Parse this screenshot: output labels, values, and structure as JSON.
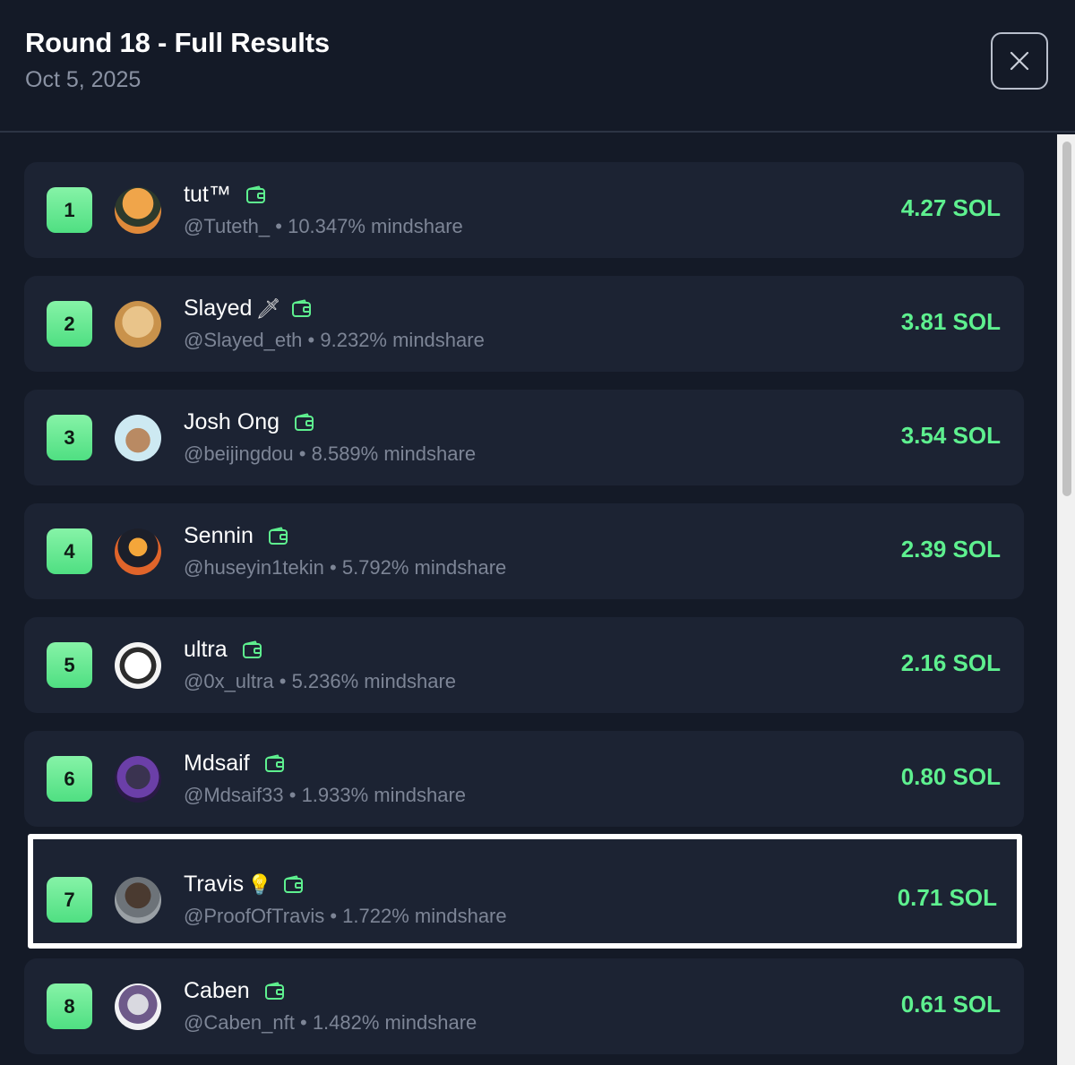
{
  "header": {
    "title": "Round 18 - Full Results",
    "date": "Oct 5, 2025"
  },
  "icons": {
    "close": "close-icon",
    "wallet": "wallet-icon"
  },
  "colors": {
    "accent": "#5ef08f",
    "rank_badge": "#5ee38c",
    "background": "#141a27",
    "card": "#1c2333",
    "muted_text": "#7d8596"
  },
  "results": [
    {
      "rank": "1",
      "name": "tut™",
      "emoji": "",
      "handle": "@Tuteth_",
      "mindshare": "10.347% mindshare",
      "reward": "4.27 SOL",
      "highlighted": false
    },
    {
      "rank": "2",
      "name": "Slayed",
      "emoji": "🗡",
      "handle": "@Slayed_eth",
      "mindshare": "9.232% mindshare",
      "reward": "3.81 SOL",
      "highlighted": false
    },
    {
      "rank": "3",
      "name": "Josh Ong",
      "emoji": "",
      "handle": "@beijingdou",
      "mindshare": "8.589% mindshare",
      "reward": "3.54 SOL",
      "highlighted": false
    },
    {
      "rank": "4",
      "name": "Sennin",
      "emoji": "",
      "handle": "@huseyin1tekin",
      "mindshare": "5.792% mindshare",
      "reward": "2.39 SOL",
      "highlighted": false
    },
    {
      "rank": "5",
      "name": "ultra",
      "emoji": "",
      "handle": "@0x_ultra",
      "mindshare": "5.236% mindshare",
      "reward": "2.16 SOL",
      "highlighted": false
    },
    {
      "rank": "6",
      "name": "Mdsaif",
      "emoji": "",
      "handle": "@Mdsaif33",
      "mindshare": "1.933% mindshare",
      "reward": "0.80 SOL",
      "highlighted": false
    },
    {
      "rank": "7",
      "name": "Travis",
      "emoji": "💡",
      "handle": "@ProofOfTravis",
      "mindshare": "1.722% mindshare",
      "reward": "0.71 SOL",
      "highlighted": true
    },
    {
      "rank": "8",
      "name": "Caben",
      "emoji": "",
      "handle": "@Caben_nft",
      "mindshare": "1.482% mindshare",
      "reward": "0.61 SOL",
      "highlighted": false
    }
  ]
}
